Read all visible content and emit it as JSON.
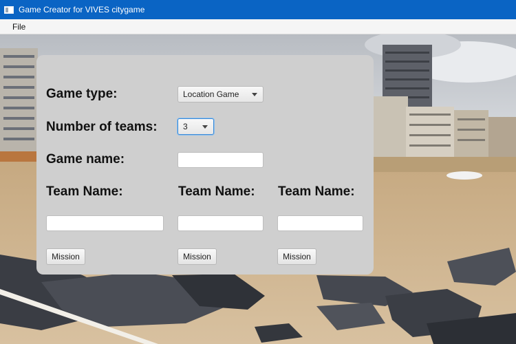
{
  "window": {
    "title": "Game Creator for VIVES citygame",
    "icon": "java-app-icon"
  },
  "menubar": {
    "items": [
      {
        "label": "File"
      }
    ]
  },
  "form": {
    "game_type": {
      "label": "Game type:",
      "selected": "Location Game"
    },
    "number_of_teams": {
      "label": "Number of teams:",
      "selected": "3"
    },
    "game_name": {
      "label": "Game name:",
      "value": ""
    },
    "teams": [
      {
        "label": "Team Name:",
        "value": "",
        "mission_label": "Mission"
      },
      {
        "label": "Team Name:",
        "value": "",
        "mission_label": "Mission"
      },
      {
        "label": "Team Name:",
        "value": "",
        "mission_label": "Mission"
      }
    ]
  },
  "colors": {
    "titlebar": "#0a64c4",
    "panel": "#cfcfcf",
    "focus": "#3a8ad6"
  }
}
